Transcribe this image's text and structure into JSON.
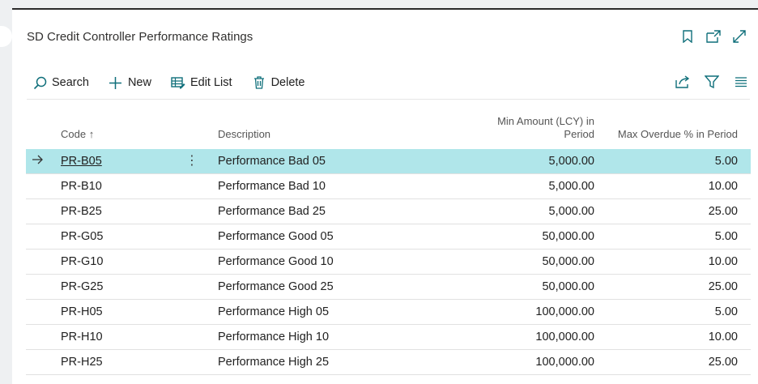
{
  "page": {
    "title": "SD Credit Controller Performance Ratings"
  },
  "toolbar": {
    "search_label": "Search",
    "new_label": "New",
    "edit_list_label": "Edit List",
    "delete_label": "Delete"
  },
  "columns": {
    "code": "Code ↑",
    "description": "Description",
    "min_amount_line1": "Min Amount (LCY) in",
    "min_amount_line2": "Period",
    "max_overdue": "Max Overdue % in Period"
  },
  "rows": [
    {
      "code": "PR-B05",
      "description": "Performance Bad 05",
      "min_amount": "5,000.00",
      "max_overdue": "5.00"
    },
    {
      "code": "PR-B10",
      "description": "Performance Bad 10",
      "min_amount": "5,000.00",
      "max_overdue": "10.00"
    },
    {
      "code": "PR-B25",
      "description": "Performance Bad 25",
      "min_amount": "5,000.00",
      "max_overdue": "25.00"
    },
    {
      "code": "PR-G05",
      "description": "Performance Good 05",
      "min_amount": "50,000.00",
      "max_overdue": "5.00"
    },
    {
      "code": "PR-G10",
      "description": "Performance Good 10",
      "min_amount": "50,000.00",
      "max_overdue": "10.00"
    },
    {
      "code": "PR-G25",
      "description": "Performance Good 25",
      "min_amount": "50,000.00",
      "max_overdue": "25.00"
    },
    {
      "code": "PR-H05",
      "description": "Performance High 05",
      "min_amount": "100,000.00",
      "max_overdue": "5.00"
    },
    {
      "code": "PR-H10",
      "description": "Performance High 10",
      "min_amount": "100,000.00",
      "max_overdue": "10.00"
    },
    {
      "code": "PR-H25",
      "description": "Performance High 25",
      "min_amount": "100,000.00",
      "max_overdue": "25.00"
    }
  ],
  "selected_row_index": 0,
  "colors": {
    "selected_row": "#b0e6ea",
    "accent": "#0f6f7a"
  },
  "icons": {
    "title_actions": [
      "bookmark-icon",
      "open-in-new-window-icon",
      "expand-icon"
    ],
    "toolbar_right": [
      "share-icon",
      "filter-icon",
      "list-view-icon"
    ]
  }
}
